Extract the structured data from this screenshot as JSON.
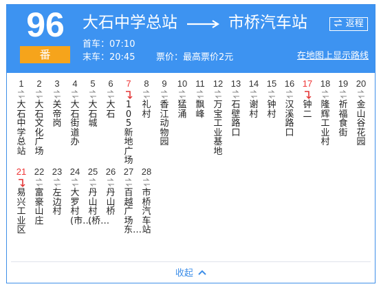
{
  "route": {
    "number": "96",
    "suffix": "番"
  },
  "origin": "大石中学总站",
  "destination": "市桥汽车站",
  "return_label": "返程",
  "first_bus": "首车：07:10",
  "last_bus": "末车：20:45",
  "fare": "票价：最高票价2元",
  "map_link": "在地图上显示路线",
  "collapse_label": "收起",
  "colors": {
    "header": "#3d93f1",
    "badge": "#f6a41b",
    "highlight": "#e33333"
  },
  "stops": [
    {
      "num": "1",
      "name": "大石中学总站",
      "dir": "both"
    },
    {
      "num": "2",
      "name": "大石文化广场",
      "dir": "both"
    },
    {
      "num": "3",
      "name": "关帝岗",
      "dir": "both"
    },
    {
      "num": "4",
      "name": "大石街道办",
      "dir": "both"
    },
    {
      "num": "5",
      "name": "大石城",
      "dir": "both"
    },
    {
      "num": "6",
      "name": "大石",
      "dir": "both"
    },
    {
      "num": "7",
      "name": "105新地广场",
      "dir": "up"
    },
    {
      "num": "8",
      "name": "礼村",
      "dir": "both"
    },
    {
      "num": "9",
      "name": "香江动物园",
      "dir": "both"
    },
    {
      "num": "10",
      "name": "猛涌",
      "dir": "both"
    },
    {
      "num": "11",
      "name": "飘峰",
      "dir": "both"
    },
    {
      "num": "12",
      "name": "万宝工业基地",
      "dir": "both"
    },
    {
      "num": "13",
      "name": "石壁路口",
      "dir": "both"
    },
    {
      "num": "14",
      "name": "谢村",
      "dir": "both"
    },
    {
      "num": "15",
      "name": "钟村",
      "dir": "both"
    },
    {
      "num": "16",
      "name": "汉溪路口",
      "dir": "both"
    },
    {
      "num": "17",
      "name": "钟二",
      "dir": "up"
    },
    {
      "num": "18",
      "name": "隆辉工业村",
      "dir": "both"
    },
    {
      "num": "19",
      "name": "祈福食街",
      "dir": "both"
    },
    {
      "num": "20",
      "name": "金山谷花园",
      "dir": "both"
    },
    {
      "num": "21",
      "name": "易兴工业区",
      "dir": "up"
    },
    {
      "num": "22",
      "name": "富豪山庄",
      "dir": "both"
    },
    {
      "num": "23",
      "name": "左边村",
      "dir": "both"
    },
    {
      "num": "24",
      "name": "大罗村(市…",
      "dir": "both"
    },
    {
      "num": "25",
      "name": "丹山村(桥…",
      "dir": "both"
    },
    {
      "num": "26",
      "name": "丹山桥",
      "dir": "both"
    },
    {
      "num": "27",
      "name": "百越广场东…",
      "dir": "both"
    },
    {
      "num": "28",
      "name": "市桥汽车站",
      "dir": "both"
    }
  ]
}
